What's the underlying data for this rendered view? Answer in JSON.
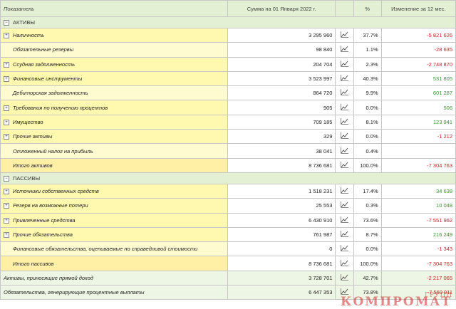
{
  "header": {
    "indicator": "Показатель",
    "amount": "Сумма на 01 Января 2022 г.",
    "percent": "%",
    "change": "Изменение за 12 мес."
  },
  "sections": {
    "assets": "АКТИВЫ",
    "liabilities": "ПАССИВЫ"
  },
  "rows": [
    {
      "label": "Наличность",
      "amount": "3 295 960",
      "percent": "37.7%",
      "change": "-5 821 626"
    },
    {
      "label": "Обязательные резервы",
      "amount": "98 840",
      "percent": "1.1%",
      "change": "-28 635"
    },
    {
      "label": "Ссудная задолженность",
      "amount": "204 704",
      "percent": "2.3%",
      "change": "-2 748 870"
    },
    {
      "label": "Финансовые инструменты",
      "amount": "3 523 997",
      "percent": "40.3%",
      "change": "531 805"
    },
    {
      "label": "Дебиторская задолженность",
      "amount": "864 720",
      "percent": "9.9%",
      "change": "601 287"
    },
    {
      "label": "Требования по получению процентов",
      "amount": "905",
      "percent": "0.0%",
      "change": "506"
    },
    {
      "label": "Имущество",
      "amount": "709 185",
      "percent": "8.1%",
      "change": "123 941"
    },
    {
      "label": "Прочие активы",
      "amount": "329",
      "percent": "0.0%",
      "change": "-1 212"
    },
    {
      "label": "Отложенный налог на прибыль",
      "amount": "38 041",
      "percent": "0.4%",
      "change": ""
    },
    {
      "label": "Итого активов",
      "amount": "8 736 681",
      "percent": "100.0%",
      "change": "-7 304 763"
    },
    {
      "label": "Источники собственных средств",
      "amount": "1 518 231",
      "percent": "17.4%",
      "change": "34 638"
    },
    {
      "label": "Резерв на возможные потери",
      "amount": "25 553",
      "percent": "0.3%",
      "change": "10 048"
    },
    {
      "label": "Привлеченные средства",
      "amount": "6 430 910",
      "percent": "73.6%",
      "change": "-7 551 962"
    },
    {
      "label": "Прочие обязательства",
      "amount": "761 987",
      "percent": "8.7%",
      "change": "216 249"
    },
    {
      "label": "Финансовые обязательства, оцениваемые по справедливой стоимости",
      "amount": "0",
      "percent": "0.0%",
      "change": "-1 343"
    },
    {
      "label": "Итого пассивов",
      "amount": "8 736 681",
      "percent": "100.0%",
      "change": "-7 304 763"
    },
    {
      "label": "Активы, приносящие прямой доход",
      "amount": "3 728 701",
      "percent": "42.7%",
      "change": "-2 217 065"
    },
    {
      "label": "Обязательства, генерирующие процентные выплаты",
      "amount": "6 447 353",
      "percent": "73.8%",
      "change": "-7 560 911"
    }
  ],
  "watermark": {
    "main": "КОМПРОМАТ",
    "small": "ГРУПП"
  },
  "colors": {
    "negative": "#d42020",
    "positive": "#2e9a2e",
    "header_bg": "#e3f0d3",
    "label_bg": "#fff9b0"
  },
  "icons": {
    "expand": "plus-box-icon",
    "chart": "line-chart-icon"
  }
}
